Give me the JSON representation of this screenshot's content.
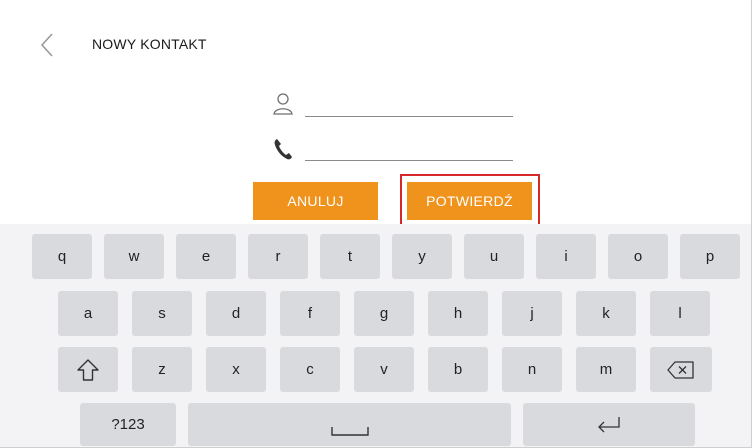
{
  "header": {
    "title": "NOWY KONTAKT"
  },
  "form": {
    "name_value": "",
    "phone_value": ""
  },
  "actions": {
    "cancel_label": "ANULUJ",
    "confirm_label": "POTWIERDŹ"
  },
  "highlight": {
    "target": "confirm-button",
    "color": "#d62828"
  },
  "colors": {
    "accent": "#f0931c",
    "key": "#d9dadd",
    "keyboard_bg": "#f3f3f5"
  },
  "keyboard": {
    "row1": [
      "q",
      "w",
      "e",
      "r",
      "t",
      "y",
      "u",
      "i",
      "o",
      "p"
    ],
    "row2": [
      "a",
      "s",
      "d",
      "f",
      "g",
      "h",
      "j",
      "k",
      "l"
    ],
    "row3": [
      "z",
      "x",
      "c",
      "v",
      "b",
      "n",
      "m"
    ],
    "mode_label": "?123",
    "icons": [
      "shift-icon",
      "backspace-icon",
      "space-icon",
      "enter-icon"
    ]
  }
}
